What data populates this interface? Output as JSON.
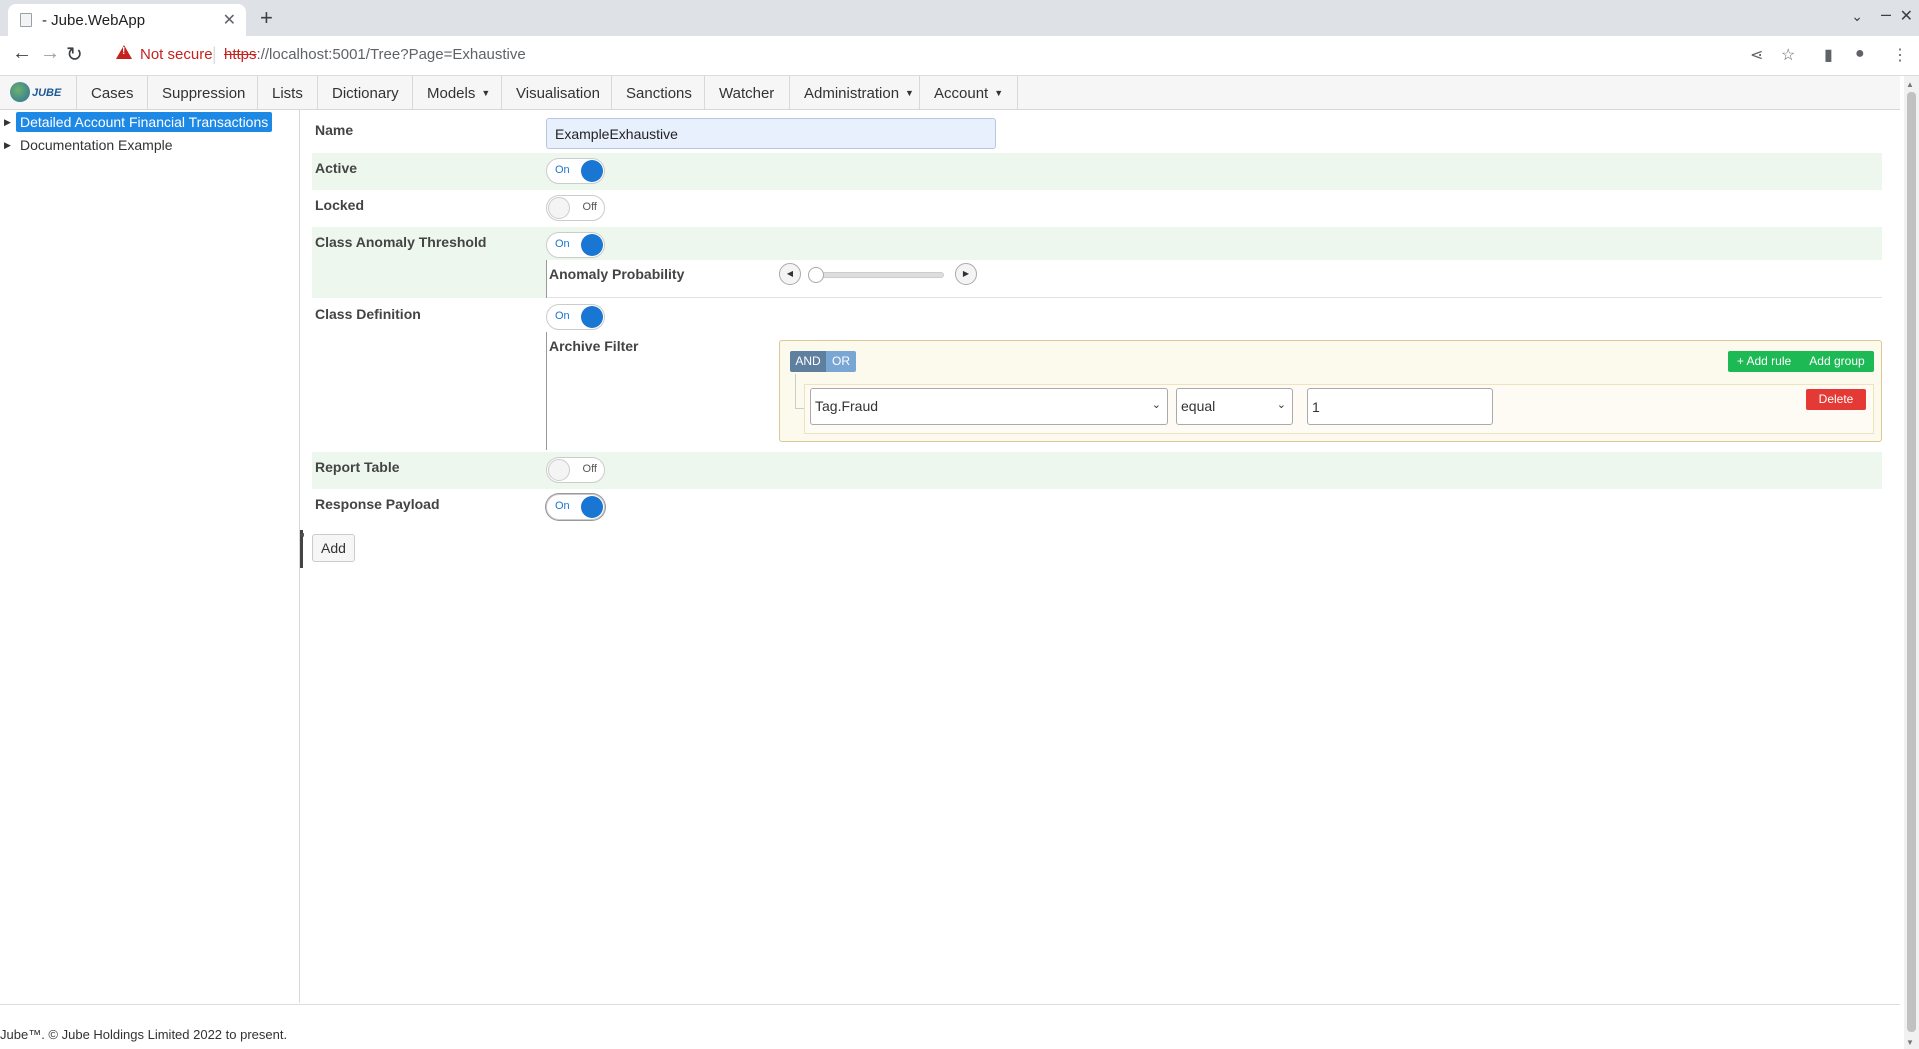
{
  "browser": {
    "tab_title": "- Jube.WebApp",
    "not_secure": "Not secure",
    "url_scheme": "https",
    "url_rest": "://localhost:5001/Tree?Page=Exhaustive"
  },
  "nav": {
    "logo_text": "JUBE",
    "items": [
      {
        "label": "Cases"
      },
      {
        "label": "Suppression"
      },
      {
        "label": "Lists"
      },
      {
        "label": "Dictionary"
      },
      {
        "label": "Models",
        "has_caret": true
      },
      {
        "label": "Visualisation"
      },
      {
        "label": "Sanctions"
      },
      {
        "label": "Watcher"
      },
      {
        "label": "Administration",
        "has_caret": true
      },
      {
        "label": "Account",
        "has_caret": true
      }
    ]
  },
  "tree": {
    "items": [
      {
        "label": "Detailed Account Financial Transactions",
        "selected": true
      },
      {
        "label": "Documentation Example",
        "selected": false
      }
    ]
  },
  "form": {
    "name_label": "Name",
    "name_value": "ExampleExhaustive",
    "active_label": "Active",
    "active_state": "On",
    "locked_label": "Locked",
    "locked_state": "Off",
    "cat_label": "Class Anomaly Threshold",
    "cat_state": "On",
    "anomaly_prob_label": "Anomaly Probability",
    "anomaly_prob_value": 0,
    "class_def_label": "Class Definition",
    "class_def_state": "On",
    "archive_filter_label": "Archive Filter",
    "report_table_label": "Report Table",
    "report_table_state": "Off",
    "response_payload_label": "Response Payload",
    "response_payload_state": "On",
    "add_button": "Add"
  },
  "query_builder": {
    "and_label": "AND",
    "or_label": "OR",
    "add_rule_label": "+ Add rule",
    "add_group_label": "Add group",
    "rule": {
      "field": "Tag.Fraud",
      "operator": "equal",
      "value": "1"
    },
    "delete_label": "Delete"
  },
  "footer": {
    "text": "Jube™. © Jube Holdings Limited 2022 to present."
  },
  "colors": {
    "accent": "#1976d2",
    "row_shade": "#eef7ee",
    "add_green": "#1db954",
    "delete_red": "#e53935",
    "not_secure_red": "#c5221f"
  }
}
